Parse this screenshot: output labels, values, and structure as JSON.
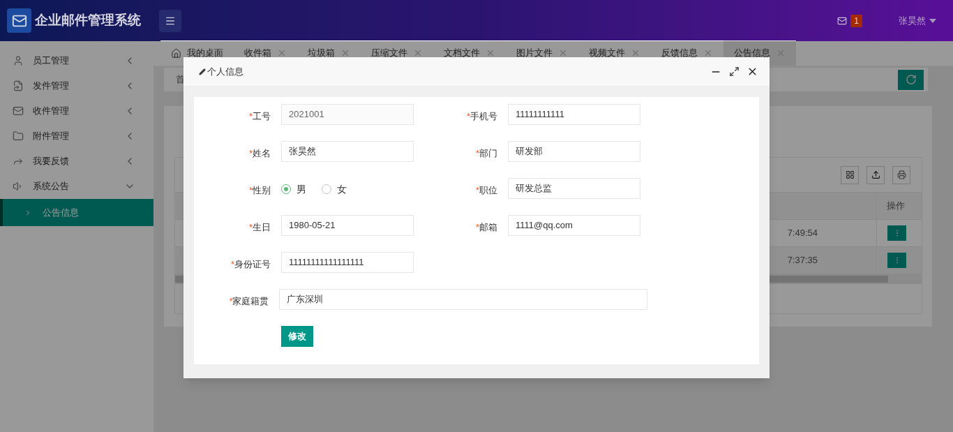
{
  "header": {
    "title": "企业邮件管理系统",
    "mail_count": "1",
    "user": "张昊然"
  },
  "sidebar": {
    "items": [
      {
        "label": "员工管理",
        "expanded": false
      },
      {
        "label": "发件管理",
        "expanded": false
      },
      {
        "label": "收件管理",
        "expanded": false
      },
      {
        "label": "附件管理",
        "expanded": false
      },
      {
        "label": "我要反馈",
        "expanded": false
      },
      {
        "label": "系统公告",
        "expanded": true,
        "children": [
          {
            "label": "公告信息",
            "selected": true
          }
        ]
      }
    ]
  },
  "tabs": [
    {
      "label": "我的桌面",
      "kind": "home",
      "selected": false
    },
    {
      "label": "收件箱",
      "kind": "closable",
      "selected": false
    },
    {
      "label": "垃圾箱",
      "kind": "closable",
      "selected": false
    },
    {
      "label": "压缩文件",
      "kind": "closable",
      "selected": false
    },
    {
      "label": "文档文件",
      "kind": "closable",
      "selected": false
    },
    {
      "label": "图片文件",
      "kind": "closable",
      "selected": false
    },
    {
      "label": "视频文件",
      "kind": "closable",
      "selected": false
    },
    {
      "label": "反馈信息",
      "kind": "closable",
      "selected": false
    },
    {
      "label": "公告信息",
      "kind": "closable",
      "selected": true
    }
  ],
  "breadcrumb": "首",
  "table": {
    "columns": [
      "操作"
    ],
    "rows": [
      {
        "time": "7:49:54"
      },
      {
        "time": "7:37:35"
      }
    ]
  },
  "modal": {
    "title": "个人信息",
    "submit": "修改",
    "fields": [
      {
        "kind": "input",
        "mark": "*",
        "label": "工号",
        "value": "2021001",
        "disabled": true
      },
      {
        "kind": "input",
        "mark": "*",
        "label": "手机号",
        "value": "11111111111",
        "disabled": false
      },
      {
        "kind": "input",
        "mark": "*",
        "label": "姓名",
        "value": "张昊然",
        "disabled": false
      },
      {
        "kind": "input",
        "mark": "*",
        "label": "部门",
        "value": "研发部",
        "disabled": false
      },
      {
        "kind": "radio",
        "mark": "*",
        "label": "性别",
        "options": [
          {
            "label": "男",
            "selected": true
          },
          {
            "label": "女",
            "selected": false
          }
        ]
      },
      {
        "kind": "input",
        "mark": "*",
        "label": "职位",
        "value": "研发总监",
        "disabled": false
      },
      {
        "kind": "input",
        "mark": "*",
        "label": "生日",
        "value": "1980-05-21",
        "disabled": false
      },
      {
        "kind": "input",
        "mark": "*",
        "label": "邮箱",
        "value": "1111@qq.com",
        "disabled": false
      },
      {
        "kind": "input",
        "mark": "*",
        "label": "身份证号",
        "value": "11111111111111111",
        "disabled": false
      },
      {
        "kind": "spacer"
      },
      {
        "kind": "wide",
        "mark": "*",
        "label": "家庭籍贯",
        "value": "广东深圳",
        "disabled": false
      }
    ]
  }
}
